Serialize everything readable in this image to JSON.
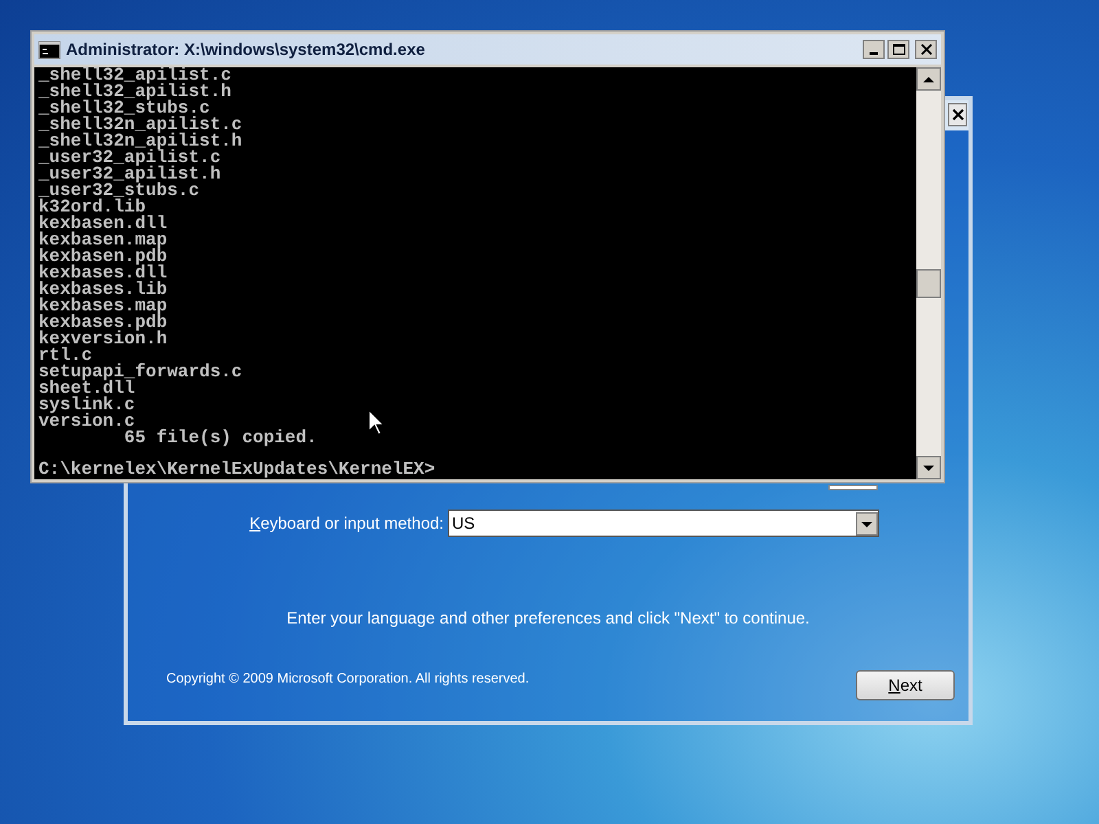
{
  "console_window": {
    "title": "Administrator: X:\\windows\\system32\\cmd.exe",
    "lines": [
      "_shell32_apilist.c",
      "_shell32_apilist.h",
      "_shell32_stubs.c",
      "_shell32n_apilist.c",
      "_shell32n_apilist.h",
      "_user32_apilist.c",
      "_user32_apilist.h",
      "_user32_stubs.c",
      "k32ord.lib",
      "kexbasen.dll",
      "kexbasen.map",
      "kexbasen.pdb",
      "kexbases.dll",
      "kexbases.lib",
      "kexbases.map",
      "kexbases.pdb",
      "kexversion.h",
      "rtl.c",
      "setupapi_forwards.c",
      "sheet.dll",
      "syslink.c",
      "version.c",
      "        65 file(s) copied."
    ],
    "prompt": "C:\\kernelex\\KernelExUpdates\\KernelEX>"
  },
  "setup_window": {
    "keyboard_label": "Keyboard or input method:",
    "keyboard_value": "US",
    "message": "Enter your language and other preferences and click \"Next\" to continue.",
    "copyright": "Copyright © 2009 Microsoft Corporation. All rights reserved.",
    "next_button": "Next"
  }
}
